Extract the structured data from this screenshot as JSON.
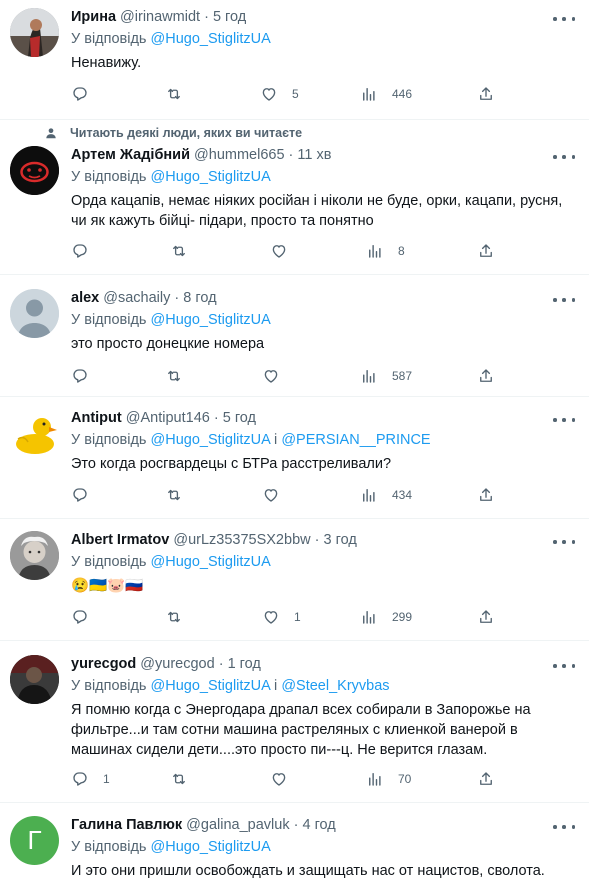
{
  "ui": {
    "reply_prefix": "У відповідь",
    "conj": "і"
  },
  "tweets": [
    {
      "name": "Ирина",
      "handle": "@irinawmidt",
      "sep": "·",
      "time": "5 год",
      "replying_to": [
        "@Hugo_StiglitzUA"
      ],
      "text": "Ненавижу.",
      "replies": "",
      "retweets": "",
      "likes": "5",
      "views": "446"
    },
    {
      "social_context": "Читають деякі люди, яких ви читаєте",
      "name": "Артем Жадібний",
      "handle": "@hummel665",
      "sep": "·",
      "time": "11 хв",
      "replying_to": [
        "@Hugo_StiglitzUA"
      ],
      "text": "Орда кацапів, немає ніяких російан і ніколи не буде, орки, кацапи, русня, чи як кажуть бійці- підари, просто та понятно",
      "replies": "",
      "retweets": "",
      "likes": "",
      "views": "8"
    },
    {
      "name": "alex",
      "handle": "@sachaily",
      "sep": "·",
      "time": "8 год",
      "replying_to": [
        "@Hugo_StiglitzUA"
      ],
      "text": "это просто донецкие номера",
      "replies": "",
      "retweets": "",
      "likes": "",
      "views": "587"
    },
    {
      "name": "Antiput",
      "handle": "@Antiput146",
      "sep": "·",
      "time": "5 год",
      "replying_to": [
        "@Hugo_StiglitzUA",
        "@PERSIAN__PRINCE"
      ],
      "text": "Это когда росгвардецы с БТРа расстреливали?",
      "replies": "",
      "retweets": "",
      "likes": "",
      "views": "434"
    },
    {
      "name": "Albert Irmatov",
      "handle": "@urLz35375SX2bbw",
      "sep": "·",
      "time": "3 год",
      "replying_to": [
        "@Hugo_StiglitzUA"
      ],
      "text": "😢🇺🇦🐷🇷🇺",
      "replies": "",
      "retweets": "",
      "likes": "1",
      "views": "299"
    },
    {
      "name": "yurecgod",
      "handle": "@yurecgod",
      "sep": "·",
      "time": "1 год",
      "replying_to": [
        "@Hugo_StiglitzUA",
        "@Steel_Kryvbas"
      ],
      "text": "Я помню когда с Энергодара драпал всех собирали в Запорожье на фильтре...и там сотни машина растреляных с клиенкой ванерой в машинах сидели дети....это просто пи---ц.  Не верится глазам.",
      "replies": "1",
      "retweets": "",
      "likes": "",
      "views": "70"
    },
    {
      "name": "Галина Павлюк",
      "handle": "@galina_pavluk",
      "sep": "·",
      "time": "4 год",
      "replying_to": [
        "@Hugo_StiglitzUA"
      ],
      "text": "И это они пришли освобождать и защищать нас от нацистов, сволота.",
      "avatar_letter": "Г",
      "replies": "",
      "retweets": "",
      "likes": "",
      "views": ""
    }
  ],
  "colors": {
    "accent": "#1d9bf0",
    "muted": "#536471",
    "text": "#0f1419",
    "divider": "#eff3f4",
    "avatar_green": "#4caf50"
  },
  "icons": {
    "reply": "reply-icon",
    "retweet": "retweet-icon",
    "like": "heart-icon",
    "views": "views-chart-icon",
    "share": "share-icon",
    "more": "more-dots-icon",
    "person": "person-icon"
  }
}
